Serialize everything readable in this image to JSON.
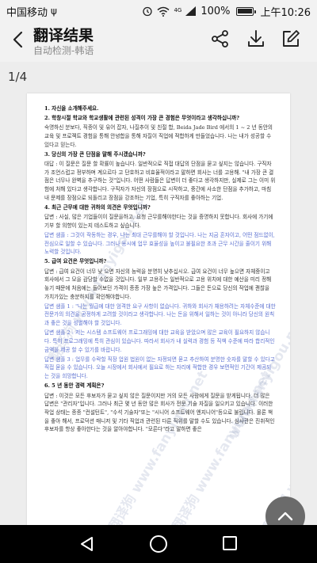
{
  "status_bar": {
    "carrier": "中国移动",
    "usb_symbol": "ψ",
    "network": "4G",
    "battery": "100%",
    "battery_level": 1.0,
    "time": "上午10:26"
  },
  "header": {
    "title": "翻译结果",
    "subtitle": "自动检测-韩语"
  },
  "pager": "1/4",
  "document": {
    "paragraphs": [
      {
        "cls": "q",
        "text": "1. 자신을 소개해주세요."
      },
      {
        "cls": "q",
        "text": "2. 학창시절 학교와 학교생활에 관련된 성격이 가장 큰 경험은 무엇이라고 생각하십니까?"
      },
      {
        "cls": "ans",
        "text": "숙명하신 분보다, 직종이 및 유어 잡자, 나질추이 및 친절 합, Beida Jade Bird 에서의 1 ~ 2 년 동안의 교육 및 프로젝트 경험을 통해 안녕합을 통해 자질이 직업에 적합하게 만들었습니다. 나는 내가 성공할 수 있다고 믿는다."
      },
      {
        "cls": "q",
        "text": "3. 당신의 가장 큰 단점을 말해 주시겠습니까?"
      },
      {
        "cls": "ans",
        "text": "대답 : 이 질문은 질문 할 확률이 높습니다. 일반적으로 직접 대답의 단점을 묻고 싶지는 않습니다. 구직자가 조언스럽고 정부하며 계으르다 고 단호하고 비효율적이라고 말하면 회사는 너를 고용해. \"내 가장 큰 결점은 너무나 완벽을 추구하는 것\"입니다. 어떤 사람들은 답변이 더 좋다고 생각하지만, 실제로 그는 이미 위험에 처해 있다고 생각합니다. 구직자가 자신의 장점으로 시작하고, 중간에 사소한 단점을 추가하고, 마침내 문제를 장점으로 되돌리고 장점을 강조하는 기업, 특히 구직자를 좋아하는 기업."
      },
      {
        "cls": "q",
        "text": "4. 최근 근무에 대한 귀하의 의견은 무엇입니까?"
      },
      {
        "cls": "ans",
        "text": "답변 : 사실, 많은 기업들이이 질문을하고, 요청 근무를해야한다는 것을 증명하지 못합니다. 회사에 가기에 기부 할 의향이 있는지 테스트하고 싶습니다."
      },
      {
        "cls": "blue",
        "text": "답변 샘플 : 그것이 작동하는 경우, 나는 최대 근무를해야 할 것입니다. 나는 지금 혼자이고, 어떤 점드없이, 전심으로 일할 수 있습니다. 그러나 동시에 업무 효율성을 높이고 불필요한 초과 근무 시간을 줄이기 위해 노력할 것입니다."
      },
      {
        "cls": "q",
        "text": "5. 급여 요건은 무엇입니까?"
      },
      {
        "cls": "ans",
        "text": "답변 : 급여 요건이 너무 낮 으면 자신의 능력을 분명히 낮추십시오. 급여 요건이 너무 높으면 자체중이고 회사에서 그 모을 감당할 수없을 것입니다. 일부 고용주는 일반적으로 고용 위치에 대한 예산을 미리 정해 놓기 때문에 처음에는 들어보던 가격이 종종 가장 높은 가격입니다. 그들은 돈으로 당신의 작업에 괜찮을 가치가있는 충분하지를 확인해야합니다."
      },
      {
        "cls": "blue",
        "text": "답변 샘플 1 : \"나는 월급에 대한 엄격한 요구 사항이 없습니다. 귀하와 회사가 채용하려는 자체수준에 대한 전문가의 의견을 공정하게 고려할 것이라고 생각합니다. 나는 돈을 위해서 일하는 것이 아니라 당신의 원칙과 좋은 것을 성별해야 할 것입니다."
      },
      {
        "cls": "blue",
        "text": "답변 샘플 2 : 저는 시스템 소프트웨어 프로그래밍에 대한 교육을 받았으며 많은 교육이 필요하지 않습니다. 특히 프로그래밍에 특히 관심이 있습니다. 따라서 회사가 내 실력과 경험 등 직책 수준에 따라 합리적인 금액을 제공 할 수 있기를 바랍니다."
      },
      {
        "cls": "blue",
        "text": "답변 샘플 3 : 업무를 수락할 직장 업원 법원이 없는 자정되면 묻고 추산하여 분명한 숫자를 말할 수 있다고 직접 묻을 수 있습니다. 오늘 시장에서 회사에서 필요로 하는 자리에 적합한 경우 보편적인 기간이 제공되는 것을 희망합니다."
      },
      {
        "cls": "q",
        "text": "6. 5 년 동안 경력 계획은?"
      },
      {
        "cls": "ans",
        "text": "답변 : 이것은 모든 후보자가 묻고 싶지 않은 질문이지만 거의 모든 사람에게 질문을 받게됩니다. 더 많은 답변은 \"관리자\"입니다. 그러나 최근 몇 년 동안 많은 회사가 전문 기술 자질을 일으키고 있습니다. 이러한 작업 상태는 종종 \"컨설턴트\", \"수석 기술자\"또는 \"시니어 소프트웨어 엔지니어\"등으로 불립니다. 물론 책을 좋아 해서, 프로덕션 매니저 및 기타 직업과 관련된 다른 직위를 말할 수도 있습니다. 심사관은 진취적인 후보자를 항상 좋아한다는 것을 알아야합니다. \"모른다\"라고 말하면 좋은"
      }
    ]
  },
  "watermarks": [
    {
      "text": "翻译狗 www.fanyigou.net"
    },
    {
      "text": "翻译狗 www.fanyigou.net"
    },
    {
      "text": "翻译狗 www.fanyigou.net"
    },
    {
      "text": "www.fanyigou.net"
    },
    {
      "text": "翻译狗 www.fanyigou.net"
    }
  ]
}
